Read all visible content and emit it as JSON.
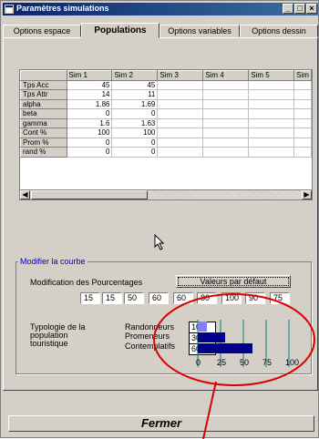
{
  "window": {
    "title": "Paramètres simulations",
    "minimize": "_",
    "maximize": "□",
    "close": "×"
  },
  "tabs": [
    {
      "label": "Options espace"
    },
    {
      "label": "Populations"
    },
    {
      "label": "Options variables"
    },
    {
      "label": "Options dessin"
    }
  ],
  "grid": {
    "columns": [
      "Sim 1",
      "Sim 2",
      "Sim 3",
      "Sim 4",
      "Sim 5",
      "Sim"
    ],
    "rows": [
      {
        "label": "Tps Acc",
        "sim1": "45",
        "sim2": "45"
      },
      {
        "label": "Tps Attr",
        "sim1": "14",
        "sim2": "11"
      },
      {
        "label": "alpha",
        "sim1": "1.86",
        "sim2": "1.69"
      },
      {
        "label": "beta",
        "sim1": "0",
        "sim2": "0"
      },
      {
        "label": "gamma",
        "sim1": "1.6",
        "sim2": "1.63"
      },
      {
        "label": "Cont %",
        "sim1": "100",
        "sim2": "100"
      },
      {
        "label": "Prom %",
        "sim1": "0",
        "sim2": "0"
      },
      {
        "label": "rand %",
        "sim1": "0",
        "sim2": "0"
      }
    ]
  },
  "curve": {
    "group_label": "Modifier la courbe",
    "modification_label": "Modification des Pourcentages",
    "default_button": "Valeurs par défaut",
    "percentages": [
      "15",
      "15",
      "50",
      "60",
      "60",
      "80",
      "100",
      "90",
      "75"
    ]
  },
  "typology": {
    "label_line1": "Typologie de la",
    "label_line2": "population",
    "label_line3": "touristique",
    "items": [
      {
        "label": "Randonneurs",
        "value": "10"
      },
      {
        "label": "Promeneurs",
        "value": "30"
      },
      {
        "label": "Contemplatifs",
        "value": "60"
      }
    ],
    "axis_ticks": [
      "0",
      "25",
      "50",
      "75",
      "100"
    ]
  },
  "chart_data": {
    "type": "bar",
    "orientation": "horizontal",
    "categories": [
      "Randonneurs",
      "Promeneurs",
      "Contemplatifs"
    ],
    "values": [
      10,
      30,
      60
    ],
    "xlim": [
      0,
      100
    ],
    "xticks": [
      0,
      25,
      50,
      75,
      100
    ]
  },
  "colors": {
    "bar_dark": "#00008b",
    "bar_light": "#8080ff",
    "grid": "#008080",
    "annotation": "#dd0000",
    "legend": "#0000c0"
  },
  "footer": {
    "close_button": "Fermer"
  }
}
